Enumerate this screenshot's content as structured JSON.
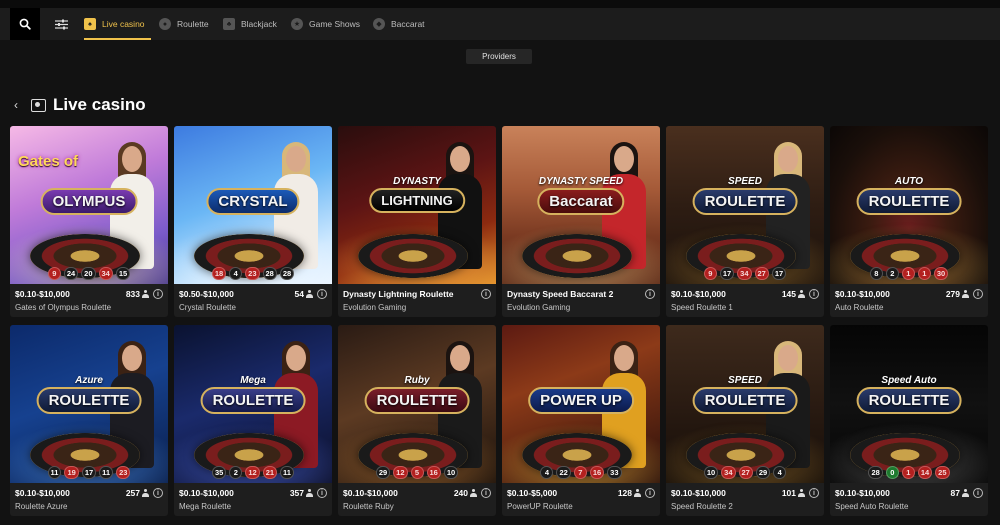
{
  "nav": {
    "search_icon": "search-icon",
    "filter_icon": "filter-sliders-icon",
    "tabs": [
      {
        "label": "Live casino",
        "icon": "live-casino-icon",
        "active": true
      },
      {
        "label": "Roulette",
        "icon": "roulette-icon",
        "active": false
      },
      {
        "label": "Blackjack",
        "icon": "blackjack-cards-icon",
        "active": false
      },
      {
        "label": "Game Shows",
        "icon": "game-shows-icon",
        "active": false
      },
      {
        "label": "Baccarat",
        "icon": "baccarat-chip-icon",
        "active": false
      }
    ],
    "accent_color": "#f0c24b"
  },
  "providers_label": "Providers",
  "page_title": "Live casino",
  "games": [
    {
      "name": "Gates of Olympus Roulette",
      "bets": "$0.10-$10,000",
      "players": "833",
      "logo_top": "Gates of",
      "logo_main": "OLYMPUS",
      "logo_pre": "",
      "theme": "olympus",
      "results": [
        {
          "n": "9",
          "c": "red"
        },
        {
          "n": "24",
          "c": "black"
        },
        {
          "n": "20",
          "c": "black"
        },
        {
          "n": "34",
          "c": "red"
        },
        {
          "n": "15",
          "c": "black"
        }
      ]
    },
    {
      "name": "Crystal Roulette",
      "bets": "$0.50-$10,000",
      "players": "54",
      "logo_top": "",
      "logo_main": "CRYSTAL",
      "logo_pre": "",
      "theme": "crystal",
      "results": [
        {
          "n": "18",
          "c": "red"
        },
        {
          "n": "4",
          "c": "black"
        },
        {
          "n": "23",
          "c": "red"
        },
        {
          "n": "28",
          "c": "black"
        },
        {
          "n": "28",
          "c": "black"
        }
      ]
    },
    {
      "name": "Evolution Gaming",
      "bets": "Dynasty Lightning Roulette",
      "players": "",
      "logo_top": "",
      "logo_main": "LIGHTNING",
      "logo_pre": "DYNASTY",
      "theme": "dynasty",
      "results": []
    },
    {
      "name": "Evolution Gaming",
      "bets": "Dynasty Speed Baccarat 2",
      "players": "",
      "logo_top": "",
      "logo_main": "Baccarat",
      "logo_pre": "DYNASTY SPEED",
      "theme": "baccarat",
      "results": []
    },
    {
      "name": "Speed Roulette 1",
      "bets": "$0.10-$10,000",
      "players": "145",
      "logo_top": "",
      "logo_main": "ROULETTE",
      "logo_pre": "SPEED",
      "theme": "speed",
      "results": [
        {
          "n": "9",
          "c": "red"
        },
        {
          "n": "17",
          "c": "black"
        },
        {
          "n": "34",
          "c": "red"
        },
        {
          "n": "27",
          "c": "red"
        },
        {
          "n": "17",
          "c": "black"
        }
      ]
    },
    {
      "name": "Auto Roulette",
      "bets": "$0.10-$10,000",
      "players": "279",
      "logo_top": "",
      "logo_main": "ROULETTE",
      "logo_pre": "AUTO",
      "theme": "auto",
      "results": [
        {
          "n": "8",
          "c": "black"
        },
        {
          "n": "2",
          "c": "black"
        },
        {
          "n": "1",
          "c": "red"
        },
        {
          "n": "1",
          "c": "red"
        },
        {
          "n": "30",
          "c": "red"
        }
      ]
    },
    {
      "name": "Roulette Azure",
      "bets": "$0.10-$10,000",
      "players": "257",
      "logo_top": "",
      "logo_main": "ROULETTE",
      "logo_pre": "Azure",
      "theme": "azure",
      "results": [
        {
          "n": "11",
          "c": "black"
        },
        {
          "n": "19",
          "c": "red"
        },
        {
          "n": "17",
          "c": "black"
        },
        {
          "n": "11",
          "c": "black"
        },
        {
          "n": "23",
          "c": "red"
        }
      ]
    },
    {
      "name": "Mega Roulette",
      "bets": "$0.10-$10,000",
      "players": "357",
      "logo_top": "",
      "logo_main": "ROULETTE",
      "logo_pre": "Mega",
      "theme": "mega",
      "results": [
        {
          "n": "35",
          "c": "black"
        },
        {
          "n": "2",
          "c": "black"
        },
        {
          "n": "12",
          "c": "red"
        },
        {
          "n": "21",
          "c": "red"
        },
        {
          "n": "11",
          "c": "black"
        }
      ]
    },
    {
      "name": "Roulette Ruby",
      "bets": "$0.10-$10,000",
      "players": "240",
      "logo_top": "",
      "logo_main": "ROULETTE",
      "logo_pre": "Ruby",
      "theme": "ruby",
      "results": [
        {
          "n": "29",
          "c": "black"
        },
        {
          "n": "12",
          "c": "red"
        },
        {
          "n": "5",
          "c": "red"
        },
        {
          "n": "16",
          "c": "red"
        },
        {
          "n": "10",
          "c": "black"
        }
      ]
    },
    {
      "name": "PowerUP Roulette",
      "bets": "$0.10-$5,000",
      "players": "128",
      "logo_top": "",
      "logo_main": "POWER UP",
      "logo_pre": "",
      "theme": "powerup",
      "results": [
        {
          "n": "4",
          "c": "black"
        },
        {
          "n": "22",
          "c": "black"
        },
        {
          "n": "7",
          "c": "red"
        },
        {
          "n": "16",
          "c": "red"
        },
        {
          "n": "33",
          "c": "black"
        }
      ]
    },
    {
      "name": "Speed Roulette 2",
      "bets": "$0.10-$10,000",
      "players": "101",
      "logo_top": "",
      "logo_main": "ROULETTE",
      "logo_pre": "SPEED",
      "theme": "speed2",
      "results": [
        {
          "n": "10",
          "c": "black"
        },
        {
          "n": "34",
          "c": "red"
        },
        {
          "n": "27",
          "c": "red"
        },
        {
          "n": "29",
          "c": "black"
        },
        {
          "n": "4",
          "c": "black"
        }
      ]
    },
    {
      "name": "Speed Auto Roulette",
      "bets": "$0.10-$10,000",
      "players": "87",
      "logo_top": "",
      "logo_main": "ROULETTE",
      "logo_pre": "Speed Auto",
      "theme": "speedauto",
      "results": [
        {
          "n": "28",
          "c": "black"
        },
        {
          "n": "0",
          "c": "green"
        },
        {
          "n": "1",
          "c": "red"
        },
        {
          "n": "14",
          "c": "red"
        },
        {
          "n": "25",
          "c": "red"
        }
      ]
    }
  ]
}
